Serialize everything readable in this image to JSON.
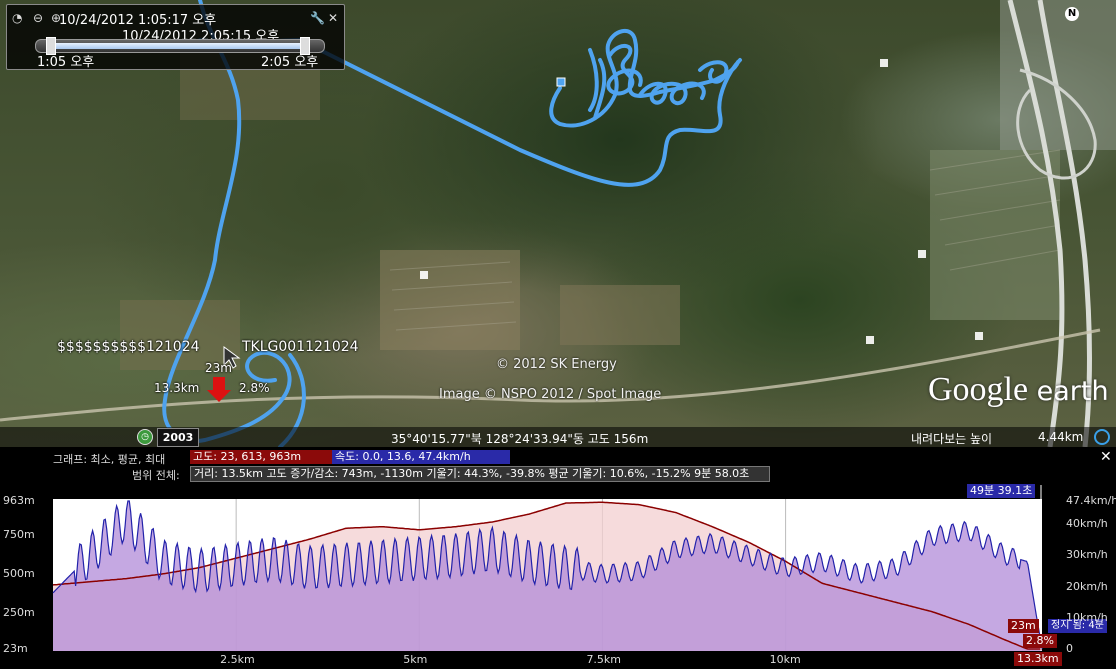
{
  "time_panel": {
    "start_top": "10/24/2012   1:05:17 오후",
    "current": "10/24/2012   2:05:15 오후",
    "range_start": "1:05 오후",
    "range_end": "2:05 오후"
  },
  "map": {
    "track_name_left": "$$$$$$$$$$121024",
    "track_name_right": "TKLG001121024",
    "marker_alt": "23m",
    "marker_dist": "13.3km",
    "marker_grade": "2.8%",
    "copyright_1": "© 2012 SK Energy",
    "copyright_2": "Image © NSPO 2012 / Spot Image",
    "logo_google": "Google",
    "logo_earth": "earth",
    "compass": "N",
    "track_color": "#4fa3ef"
  },
  "statusbar": {
    "year": "2003",
    "coords": "35°40'15.77\"북 128°24'33.94\"동 고도   156m",
    "eye_alt_label": "내려다보는 높이",
    "eye_alt_value": "4.44km"
  },
  "graph_panel": {
    "row1_label": "그래프: 최소, 평균, 최대",
    "alt_chip": "고도: 23, 613, 963m",
    "speed_chip": "속도: 0.0, 13.6, 47.4km/h",
    "row2_label": "범위 전체:",
    "range_stats": "거리: 13.5km 고도 증가/감소: 743m, -1130m 기울기: 44.3%, -39.8% 평균 기울기: 10.6%, -15.2% 9분 58.0초",
    "time_badge": "49분 39.1초",
    "cursor_alt": "23m",
    "cursor_grade": "2.8%",
    "cursor_dist": "13.3km",
    "cursor_right": "정지 됨: 4분"
  },
  "chart_data": {
    "type": "line",
    "xlabel": "",
    "x_ticks": [
      "2.5km",
      "5km",
      "7.5km",
      "10km"
    ],
    "x_tick_values": [
      2.5,
      5,
      7.5,
      10
    ],
    "xlim": [
      0,
      13.5
    ],
    "left_ticks": [
      "963m",
      "750m",
      "500m",
      "250m",
      "23m"
    ],
    "left_tick_values": [
      963,
      750,
      500,
      250,
      23
    ],
    "right_ticks": [
      "47.4km/h",
      "40km/h",
      "30km/h",
      "20km/h",
      "10km/h",
      "0"
    ],
    "right_tick_values": [
      47.4,
      40,
      30,
      20,
      10,
      0
    ],
    "series": [
      {
        "name": "고도",
        "color": "#8b0000",
        "x": [
          0,
          0.5,
          1,
          1.5,
          2,
          2.5,
          3,
          3.5,
          4,
          4.5,
          5,
          5.5,
          6,
          6.5,
          7,
          7.5,
          8,
          8.5,
          9,
          9.5,
          10,
          10.5,
          11,
          11.5,
          12,
          12.5,
          13,
          13.3,
          13.5
        ],
        "y": [
          430,
          450,
          470,
          500,
          540,
          600,
          660,
          720,
          790,
          800,
          780,
          800,
          830,
          880,
          950,
          955,
          940,
          890,
          800,
          700,
          580,
          440,
          380,
          320,
          260,
          180,
          80,
          23,
          23
        ]
      },
      {
        "name": "속도",
        "color": "#2222aa",
        "x": [
          0,
          0.5,
          1,
          1.5,
          2,
          2.5,
          3,
          3.5,
          4,
          4.5,
          5,
          5.5,
          6,
          6.5,
          7,
          7.5,
          8,
          8.5,
          9,
          9.5,
          10,
          10.5,
          11,
          11.5,
          12,
          12.5,
          13,
          13.3,
          13.5
        ],
        "y": [
          18,
          30,
          42,
          28,
          25,
          27,
          29,
          26,
          27,
          28,
          29,
          30,
          32,
          28,
          26,
          24,
          25,
          32,
          34,
          30,
          26,
          28,
          24,
          26,
          36,
          38,
          30,
          28,
          0
        ]
      }
    ]
  }
}
